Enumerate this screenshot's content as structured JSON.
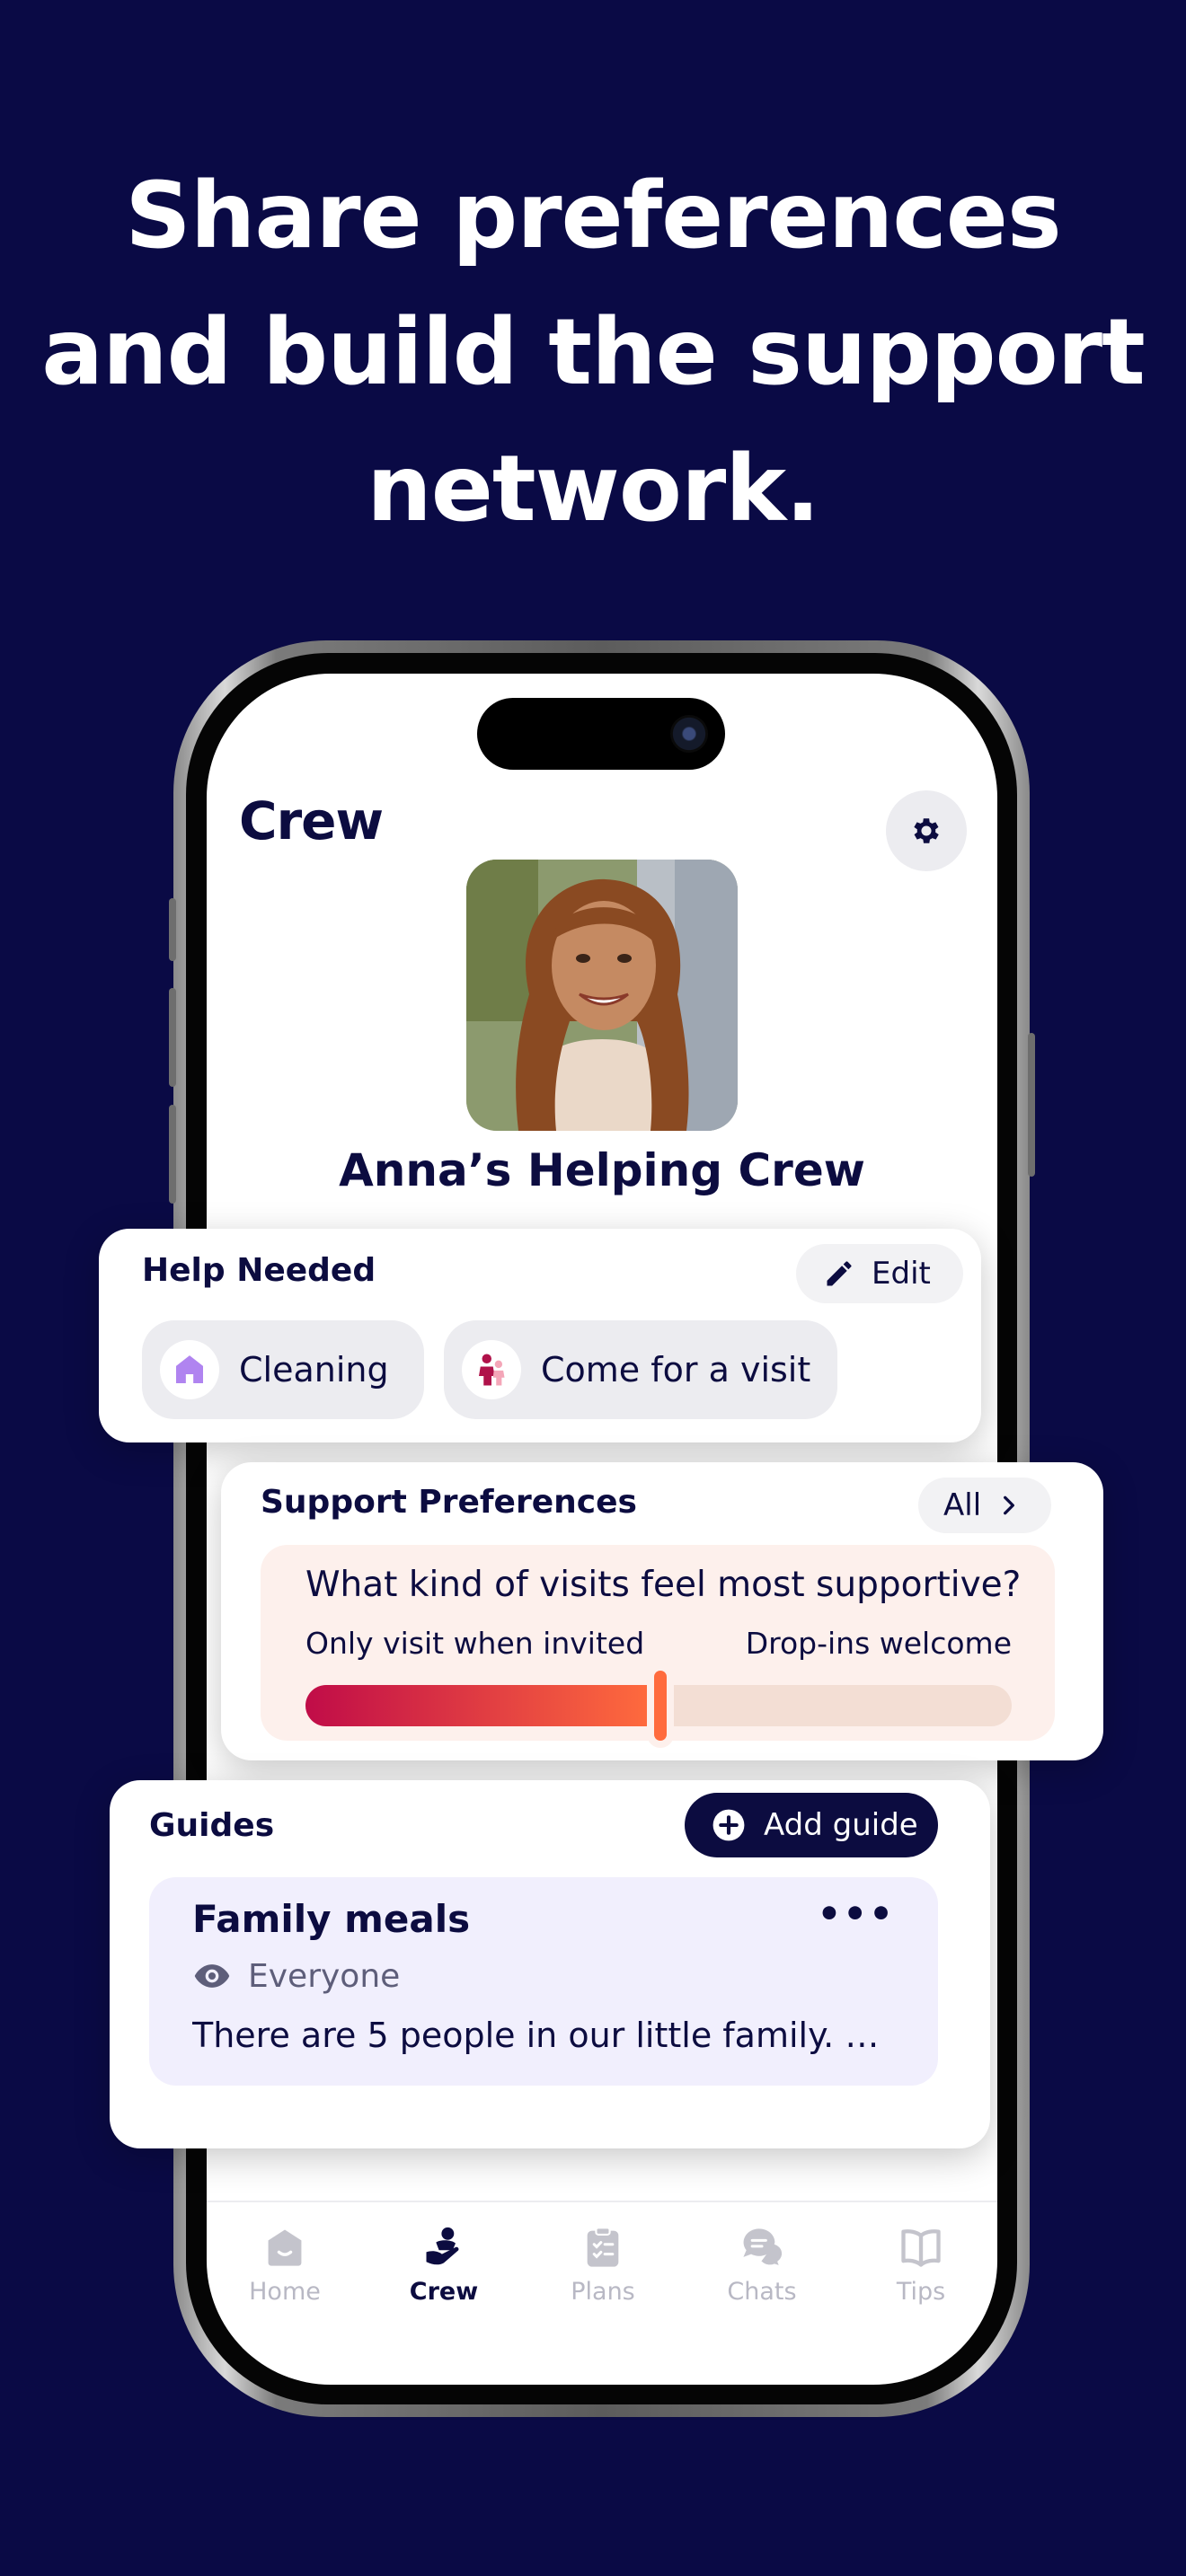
{
  "headline": {
    "line1": "Share preferences",
    "line2": "and build the support",
    "line3": "network."
  },
  "colors": {
    "background": "#0a0a45",
    "text_dark": "#0c0c40",
    "slider_start": "#c00c48",
    "slider_end": "#ff6b3d"
  },
  "screen": {
    "title": "Crew",
    "crew_name": "Anna’s Helping Crew"
  },
  "help_needed": {
    "title": "Help Needed",
    "edit_label": "Edit",
    "chips": [
      {
        "label": "Cleaning",
        "icon": "house-icon"
      },
      {
        "label": "Come for a visit",
        "icon": "people-icon"
      }
    ]
  },
  "support_preferences": {
    "title": "Support Preferences",
    "all_label": "All",
    "question": "What kind of visits feel most supportive?",
    "left_label": "Only visit when invited",
    "right_label": "Drop-ins welcome",
    "slider_value": 0.49
  },
  "guides": {
    "title": "Guides",
    "add_label": "Add guide",
    "items": [
      {
        "title": "Family meals",
        "visibility": "Everyone",
        "preview": "There are 5 people in our little family. M..."
      }
    ]
  },
  "tabbar": {
    "tabs": [
      {
        "label": "Home",
        "icon": "home-icon",
        "active": false
      },
      {
        "label": "Crew",
        "icon": "crew-icon",
        "active": true
      },
      {
        "label": "Plans",
        "icon": "clipboard-icon",
        "active": false
      },
      {
        "label": "Chats",
        "icon": "chat-icon",
        "active": false
      },
      {
        "label": "Tips",
        "icon": "book-icon",
        "active": false
      }
    ]
  }
}
